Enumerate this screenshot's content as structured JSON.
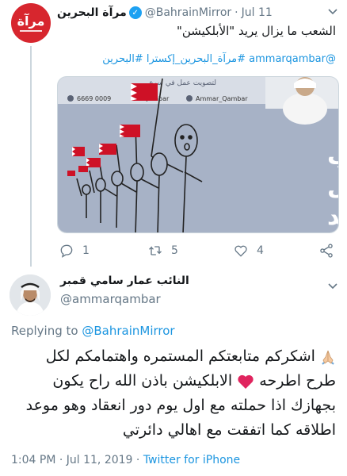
{
  "parent_tweet": {
    "display_name": "مرآة البحرين",
    "handle": "@BahrainMirror",
    "separator": "·",
    "time": "Jul 11",
    "verified_mark": "✓",
    "text": "الشعب ما يزال يريد \"الأبلكيشن\"",
    "hashtags": "@ammarqambar #مرآة_البحرين_إكسترا #البحرين",
    "avatar_logo_text": "مرآة",
    "media": {
      "overlay_text_line1": "الشعب",
      "overlay_text_line2": "ما يزال",
      "overlay_text_line3": "يريد",
      "header_phone": "6669 0009",
      "header_handle_left": "Qambar",
      "header_handle_right": "Ammar_Qambar",
      "header_top_text": "لتصويت عمل في سرع"
    },
    "actions": {
      "reply_count": "1",
      "retweet_count": "5",
      "like_count": "4"
    }
  },
  "reply_tweet": {
    "display_name": "النائب عمار سامي قمبر",
    "handle": "@ammarqambar",
    "replying_prefix": "Replying to",
    "replying_to": "@BahrainMirror",
    "body_part1": "اشكركم متابعتكم المستمره واهتمامكم لكل طرح اطرحه",
    "body_part2": "الابلكيشن باذن الله راح يكون بجهازك اذا حملته مع اول يوم دور انعقاد وهو موعد اطلاقه كما اتفقت مع اهالي دائرتي",
    "timestamp": "1:04 PM · Jul 11, 2019 ·",
    "source": "Twitter for iPhone"
  },
  "colors": {
    "brand_red": "#d7262e",
    "link_blue": "#1b95e0",
    "verified_blue": "#1da1f2",
    "muted_gray": "#657786",
    "heart_red": "#e0245e",
    "poster_bg": "#a7b2c6"
  },
  "icons": [
    "verified-icon",
    "chevron-down-icon",
    "reply-icon",
    "retweet-icon",
    "like-icon",
    "share-icon",
    "praying-hands-icon",
    "red-heart-icon"
  ]
}
